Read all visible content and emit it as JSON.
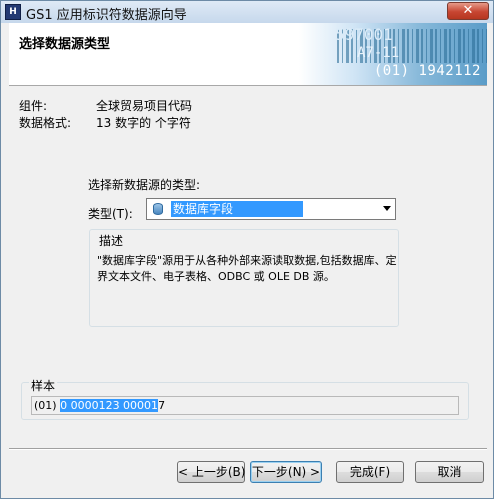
{
  "window": {
    "title": "GS1 应用标识符数据源向导",
    "icon_text": "H",
    "close_glyph": "✕"
  },
  "header": {
    "title": "选择数据源类型",
    "banner_number": "(01) 1942112",
    "banner_faint_top": "597001",
    "banner_faint_mid": "A7-11"
  },
  "info": {
    "component_label": "组件:",
    "component_value": "全球贸易项目代码",
    "format_label": "数据格式:",
    "format_value": "13 数字的 个字符"
  },
  "source": {
    "prompt": "选择新数据源的类型:",
    "type_label": "类型(T):",
    "type_value": "数据库字段",
    "type_icon": "database-icon"
  },
  "description": {
    "title": "描述",
    "text": "\"数据库字段\"源用于从各种外部来源读取数据,包括数据库、定界文本文件、电子表格、ODBC 或 OLE DB 源。"
  },
  "sample": {
    "title": "样本",
    "prefix": "(01) ",
    "selected": "0 0000123 00001",
    "suffix": "7"
  },
  "buttons": {
    "back": "< 上一步(B)",
    "next": "下一步(N) >",
    "finish": "完成(F)",
    "cancel": "取消"
  },
  "colors": {
    "selection": "#3399ff",
    "dialog_bg": "#f0f0f0",
    "close_red": "#c74632"
  }
}
